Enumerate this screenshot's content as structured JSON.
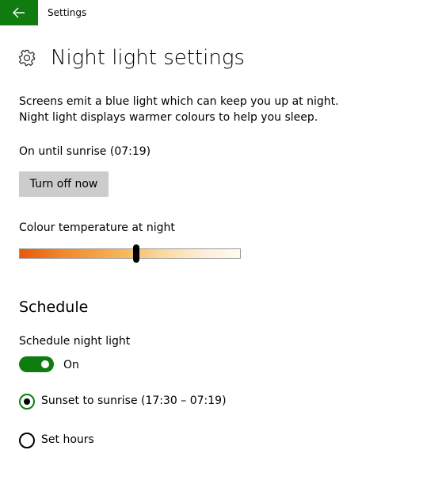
{
  "titlebar": {
    "title": "Settings",
    "back_icon": "arrow-left-icon"
  },
  "header": {
    "icon": "gear-icon",
    "title": "Night light settings"
  },
  "description": "Screens emit a blue light which can keep you up at night. Night light displays warmer colours to help you sleep.",
  "status": "On until sunrise (07:19)",
  "turn_off_button": "Turn off now",
  "colour_temperature": {
    "label": "Colour temperature at night",
    "level": 0.53
  },
  "schedule": {
    "heading": "Schedule",
    "toggle_label": "Schedule night light",
    "toggle_state": "On",
    "toggle_on": true,
    "options": [
      {
        "label": "Sunset to sunrise (17:30 – 07:19)",
        "selected": true
      },
      {
        "label": "Set hours",
        "selected": false
      }
    ]
  },
  "colors": {
    "accent": "#107c10",
    "button_bg": "#cccccc"
  }
}
